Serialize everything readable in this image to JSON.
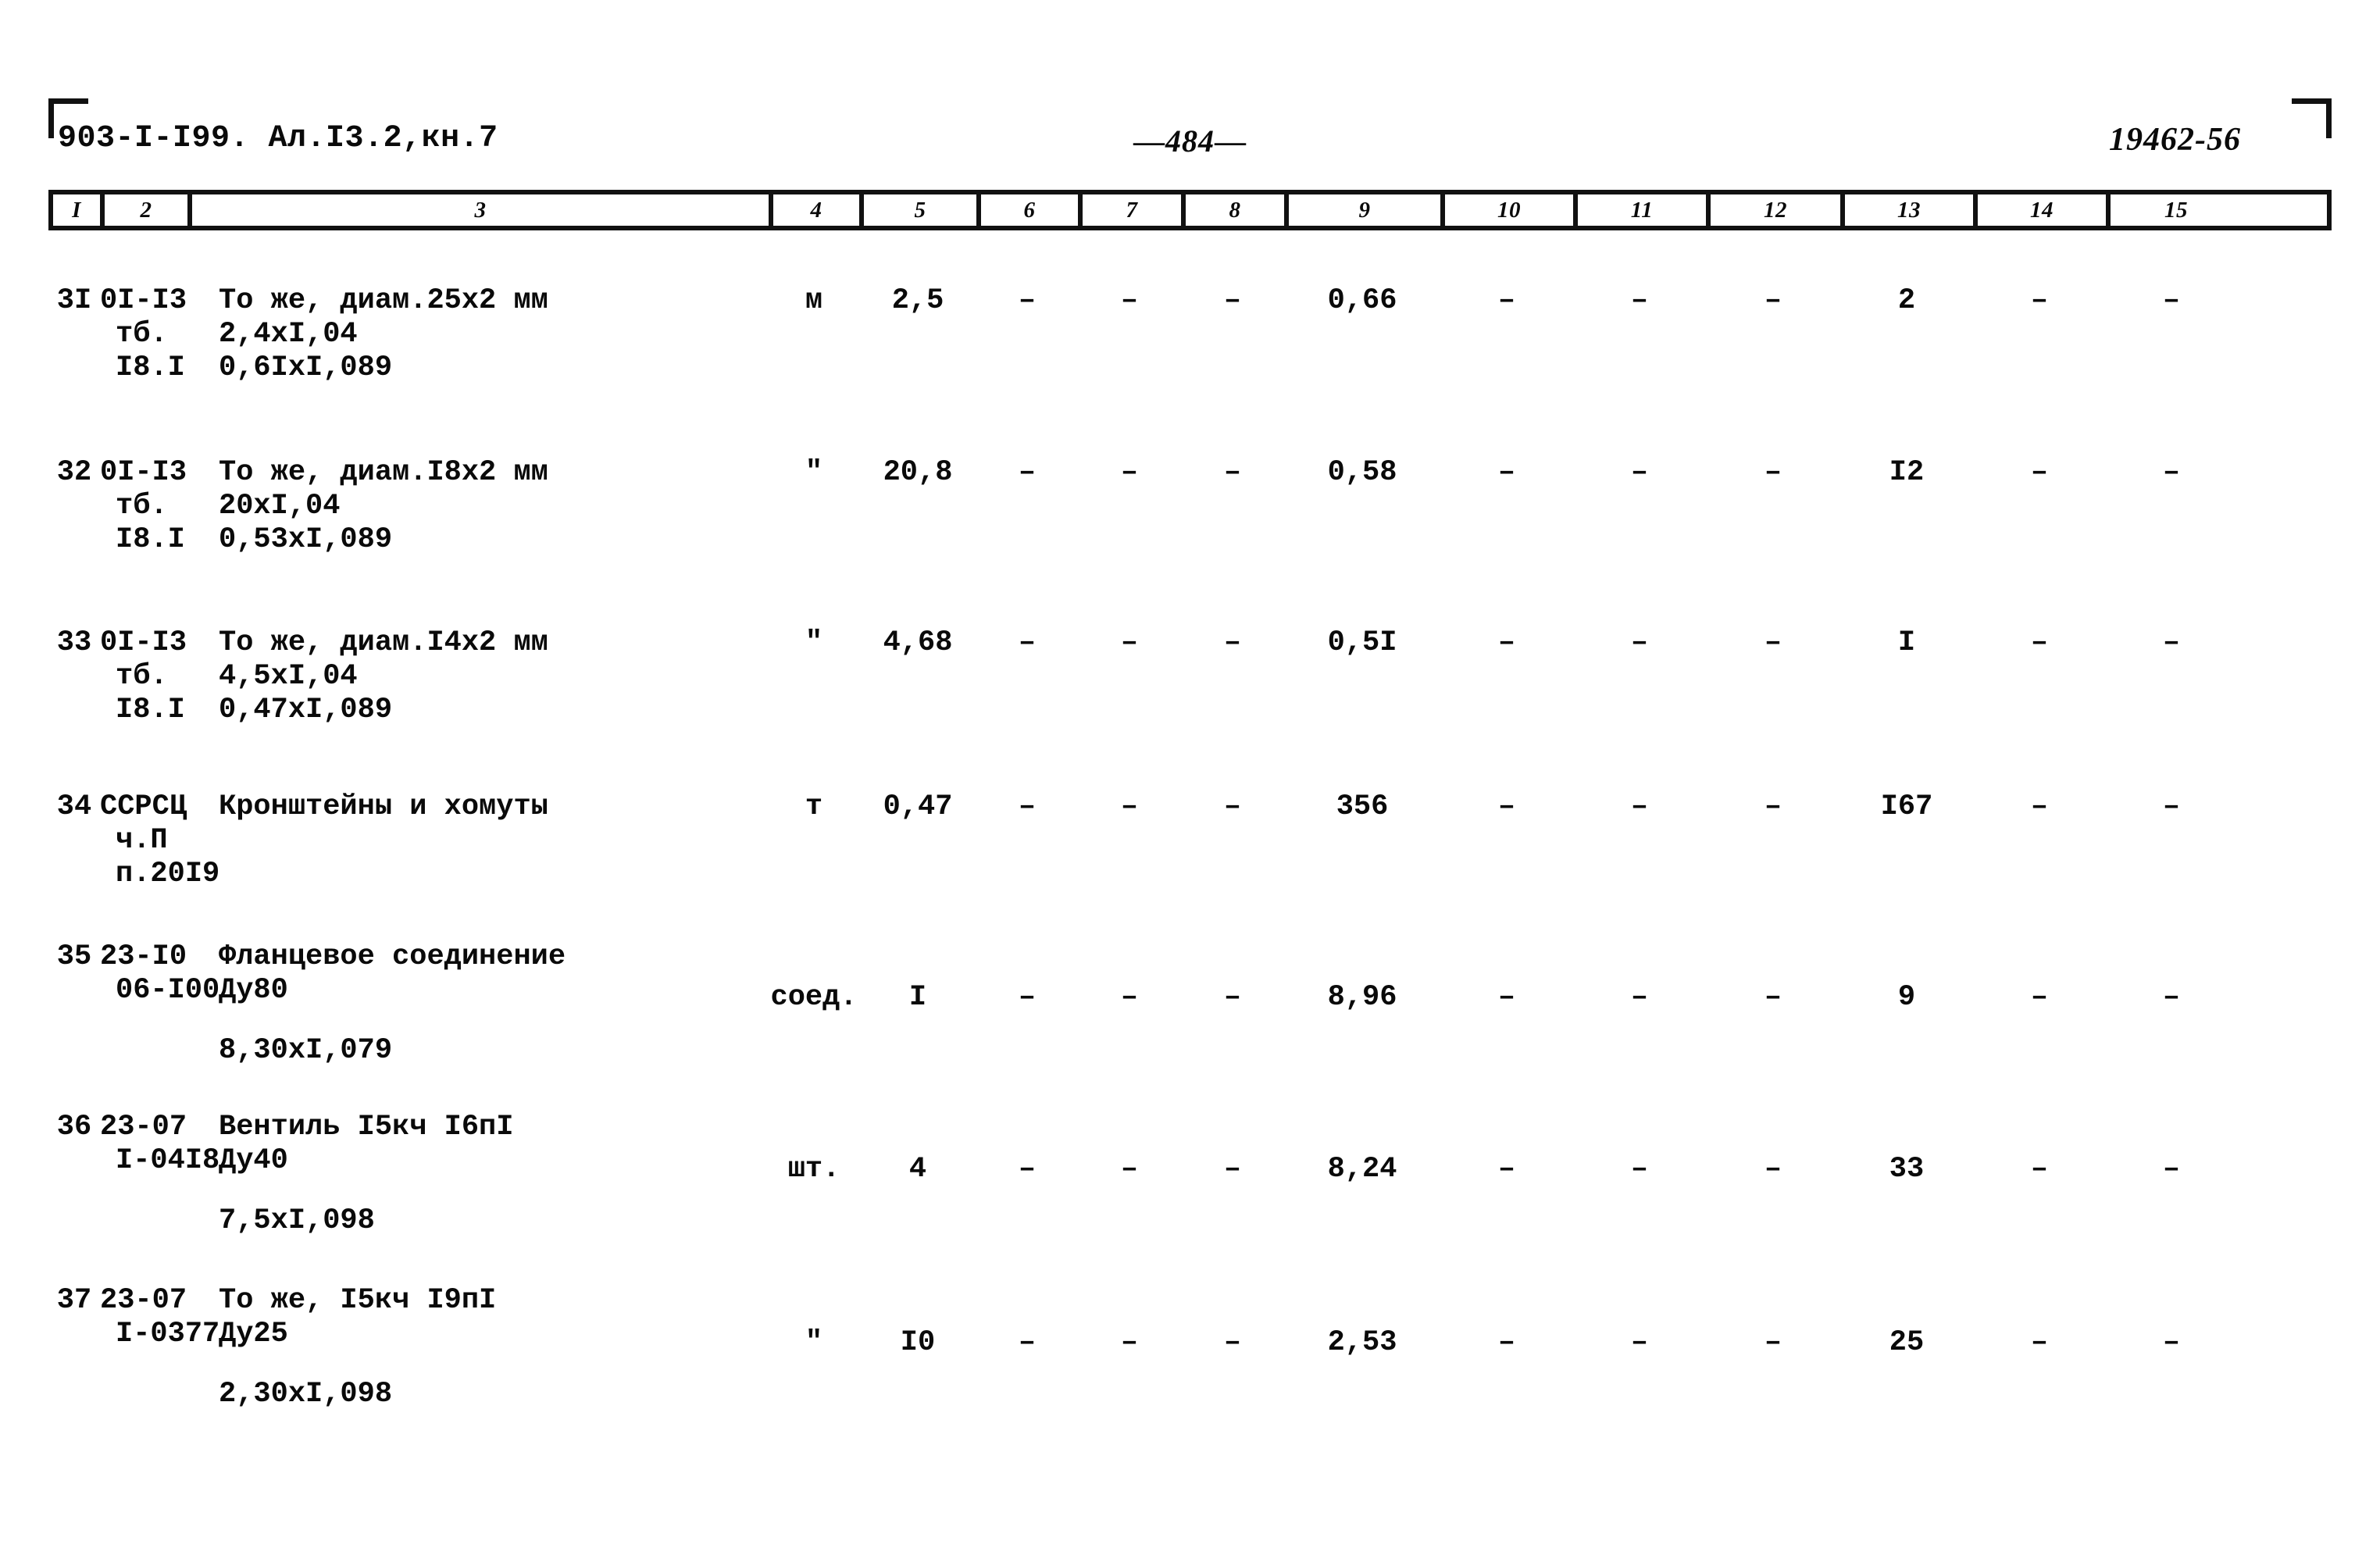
{
  "header": {
    "doc_code": "903-I-I99. Ал.I3.2,кн.7",
    "page_number": "484",
    "page_dash_left": "—",
    "page_dash_right": "—",
    "archive_code": "19462-56"
  },
  "column_numbers": [
    "I",
    "2",
    "3",
    "4",
    "5",
    "6",
    "7",
    "8",
    "9",
    "10",
    "11",
    "12",
    "13",
    "14",
    "15"
  ],
  "dash": "–",
  "rows": [
    {
      "num": "3I",
      "code_line1": "0I-I3",
      "code_line2": "тб.",
      "code_line3": "I8.I",
      "desc_line1": "То же, диам.25х2 мм",
      "desc_line2": "2,4хI,04",
      "desc_line3": "0,6IхI,089",
      "unit": "м",
      "qty": "2,5",
      "c6": "–",
      "c7": "–",
      "c8": "–",
      "c9": "0,66",
      "c10": "–",
      "c11": "–",
      "c12": "–",
      "c13": "2",
      "c14": "–",
      "c15": "–"
    },
    {
      "num": "32",
      "code_line1": "0I-I3",
      "code_line2": "тб.",
      "code_line3": "I8.I",
      "desc_line1": "То же, диам.I8х2 мм",
      "desc_line2": "20хI,04",
      "desc_line3": "0,53хI,089",
      "unit": "\"",
      "qty": "20,8",
      "c6": "–",
      "c7": "–",
      "c8": "–",
      "c9": "0,58",
      "c10": "–",
      "c11": "–",
      "c12": "–",
      "c13": "I2",
      "c14": "–",
      "c15": "–"
    },
    {
      "num": "33",
      "code_line1": "0I-I3",
      "code_line2": "тб.",
      "code_line3": "I8.I",
      "desc_line1": "То же, диам.I4х2 мм",
      "desc_line2": "4,5хI,04",
      "desc_line3": "0,47хI,089",
      "unit": "\"",
      "qty": "4,68",
      "c6": "–",
      "c7": "–",
      "c8": "–",
      "c9": "0,5I",
      "c10": "–",
      "c11": "–",
      "c12": "–",
      "c13": "I",
      "c14": "–",
      "c15": "–"
    },
    {
      "num": "34",
      "code_line1": "ССРСЦ",
      "code_line2": "ч.П",
      "code_line3": "п.20I9",
      "desc_line1": "Кронштейны и хомуты",
      "desc_line2": "",
      "desc_line3": "",
      "unit": "т",
      "qty": "0,47",
      "c6": "–",
      "c7": "–",
      "c8": "–",
      "c9": "356",
      "c10": "–",
      "c11": "–",
      "c12": "–",
      "c13": "I67",
      "c14": "–",
      "c15": "–"
    },
    {
      "num": "35",
      "code_line1": "23-I0",
      "code_line2": "06-I00",
      "code_line3": "",
      "desc_line1": "Фланцевое соединение",
      "desc_line2": "Ду80",
      "desc_line3": "8,30хI,079",
      "unit": "соед.",
      "qty": "I",
      "c6": "–",
      "c7": "–",
      "c8": "–",
      "c9": "8,96",
      "c10": "–",
      "c11": "–",
      "c12": "–",
      "c13": "9",
      "c14": "–",
      "c15": "–"
    },
    {
      "num": "36",
      "code_line1": "23-07",
      "code_line2": "I-04I8",
      "code_line3": "",
      "desc_line1": "Вентиль I5кч I6пI",
      "desc_line2": "Ду40",
      "desc_line3": "7,5хI,098",
      "unit": "шт.",
      "qty": "4",
      "c6": "–",
      "c7": "–",
      "c8": "–",
      "c9": "8,24",
      "c10": "–",
      "c11": "–",
      "c12": "–",
      "c13": "33",
      "c14": "–",
      "c15": "–"
    },
    {
      "num": "37",
      "code_line1": "23-07",
      "code_line2": "I-0377",
      "code_line3": "",
      "desc_line1": "То же, I5кч I9пI",
      "desc_line2": "Ду25",
      "desc_line3": "2,30хI,098",
      "unit": "\"",
      "qty": "I0",
      "c6": "–",
      "c7": "–",
      "c8": "–",
      "c9": "2,53",
      "c10": "–",
      "c11": "–",
      "c12": "–",
      "c13": "25",
      "c14": "–",
      "c15": "–"
    }
  ]
}
